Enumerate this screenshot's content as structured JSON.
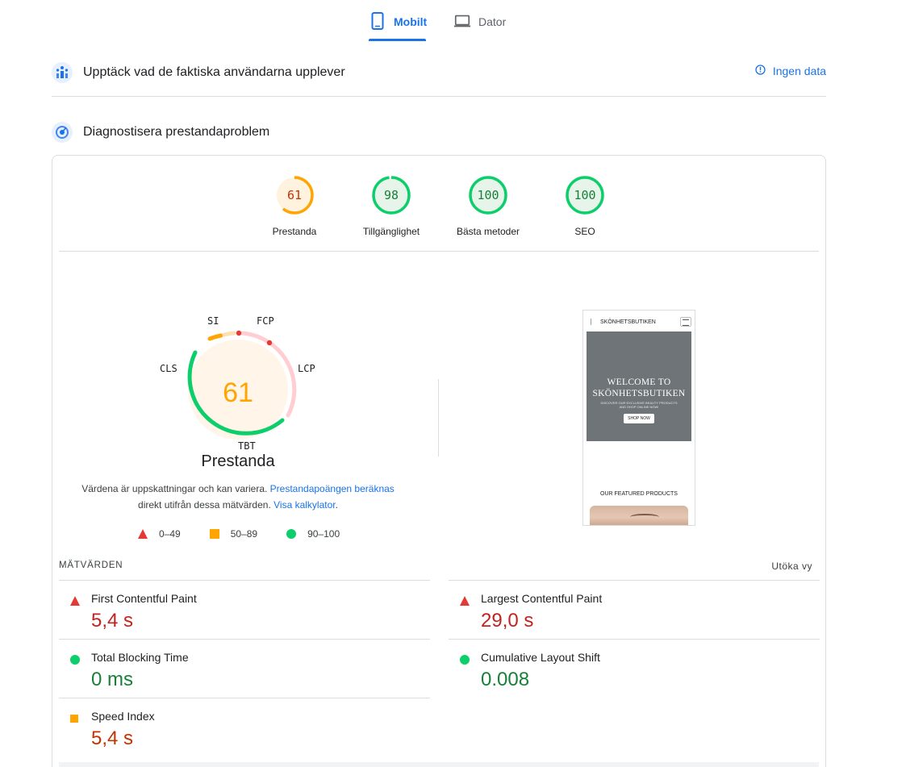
{
  "tabs": [
    {
      "label": "Mobilt",
      "icon": "smartphone-icon",
      "active": true
    },
    {
      "label": "Dator",
      "icon": "laptop-icon",
      "active": false
    }
  ],
  "field_data": {
    "title": "Upptäck vad de faktiska användarna upplever",
    "no_data_label": "Ingen data"
  },
  "lab_data": {
    "title": "Diagnostisera prestandaproblem"
  },
  "categories": [
    {
      "score": "61",
      "label": "Prestanda",
      "color": "#ffa400",
      "bg": "#fff3e0",
      "text_color": "#c33300"
    },
    {
      "score": "98",
      "label": "Tillgänglighet",
      "color": "#0cce6b",
      "bg": "#e6f4ea",
      "text_color": "#188038"
    },
    {
      "score": "100",
      "label": "Bästa metoder",
      "color": "#0cce6b",
      "bg": "#e6f4ea",
      "text_color": "#188038"
    },
    {
      "score": "100",
      "label": "SEO",
      "color": "#0cce6b",
      "bg": "#e6f4ea",
      "text_color": "#188038"
    }
  ],
  "performance": {
    "score": "61",
    "title": "Prestanda",
    "gauge_labels": {
      "si": "SI",
      "fcp": "FCP",
      "lcp": "LCP",
      "tbt": "TBT",
      "cls": "CLS"
    },
    "disclaimer_text": "Värdena är uppskattningar och kan variera.",
    "disclaimer_link1": "Prestandapoängen beräknas",
    "disclaimer_text2": "direkt utifrån dessa mätvärden.",
    "disclaimer_link2": "Visa kalkylator",
    "legend": [
      {
        "range": "0–49",
        "shape": "triangle",
        "color": "#e53935"
      },
      {
        "range": "50–89",
        "shape": "square",
        "color": "#ffa400"
      },
      {
        "range": "90–100",
        "shape": "circle",
        "color": "#0cce6b"
      }
    ]
  },
  "screenshot": {
    "brand": "SKÖNHETSBUTIKEN",
    "hero_line1": "WELCOME TO",
    "hero_line2": "SKÖNHETSBUTIKEN",
    "hero_sub1": "DISCOVER OUR EXCLUSIVE BEAUTY PRODUCTS",
    "hero_sub2": "AND SHOP ONLINE NOW!",
    "hero_button": "SHOP NOW",
    "featured": "OUR FEATURED PRODUCTS"
  },
  "metrics": {
    "heading": "MÄTVÄRDEN",
    "expand_label": "Utöka vy",
    "items": [
      {
        "name": "First Contentful Paint",
        "value": "5,4 s",
        "rating": "fail"
      },
      {
        "name": "Largest Contentful Paint",
        "value": "29,0 s",
        "rating": "fail"
      },
      {
        "name": "Total Blocking Time",
        "value": "0 ms",
        "rating": "pass"
      },
      {
        "name": "Cumulative Layout Shift",
        "value": "0.008",
        "rating": "pass"
      },
      {
        "name": "Speed Index",
        "value": "5,4 s",
        "rating": "average"
      }
    ]
  }
}
